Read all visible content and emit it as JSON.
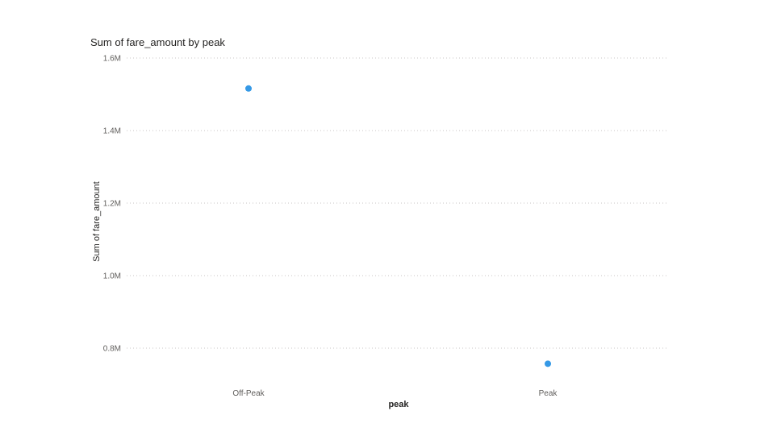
{
  "chart_data": {
    "type": "scatter",
    "title": "Sum of fare_amount by peak",
    "xlabel": "peak",
    "ylabel": "Sum of fare_amount",
    "categories": [
      "Off-Peak",
      "Peak"
    ],
    "values": [
      1516000,
      757000
    ],
    "ylim": [
      0.7,
      1.6
    ],
    "yticks": [
      {
        "value": 1.6,
        "label": "1.6M"
      },
      {
        "value": 1.4,
        "label": "1.4M"
      },
      {
        "value": 1.2,
        "label": "1.2M"
      },
      {
        "value": 1.0,
        "label": "1.0M"
      },
      {
        "value": 0.8,
        "label": "0.8M"
      }
    ],
    "grid": true,
    "legend": "none",
    "point_color": "#3599e6"
  }
}
